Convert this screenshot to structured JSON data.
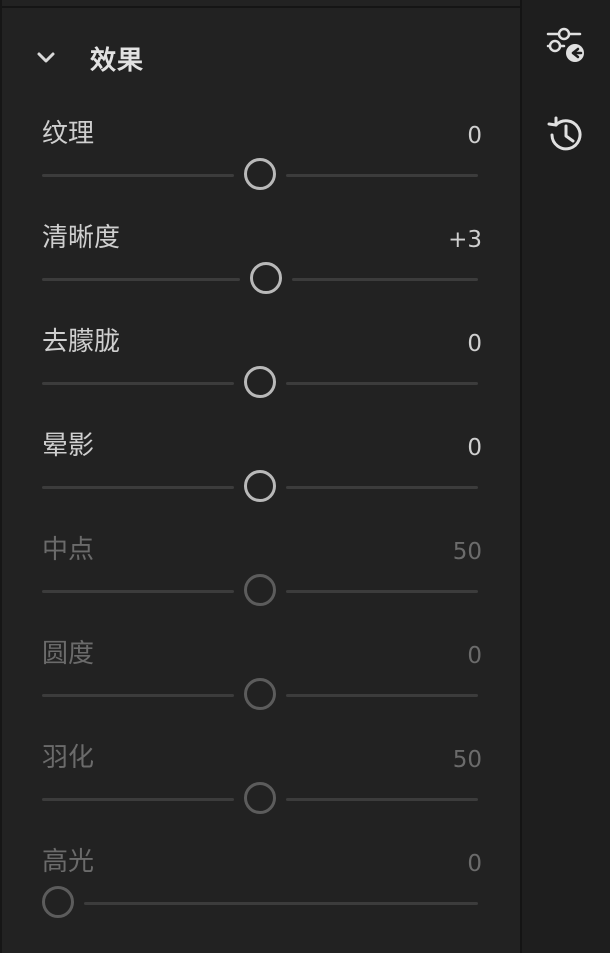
{
  "section": {
    "title": "效果",
    "expanded": true
  },
  "sliders": [
    {
      "label": "纹理",
      "value": "0",
      "numeric": 0,
      "min": -100,
      "max": 100,
      "enabled": true
    },
    {
      "label": "清晰度",
      "value": "+3",
      "numeric": 3,
      "min": -100,
      "max": 100,
      "enabled": true
    },
    {
      "label": "去朦胧",
      "value": "0",
      "numeric": 0,
      "min": -100,
      "max": 100,
      "enabled": true
    },
    {
      "label": "晕影",
      "value": "0",
      "numeric": 0,
      "min": -100,
      "max": 100,
      "enabled": true
    },
    {
      "label": "中点",
      "value": "50",
      "numeric": 50,
      "min": 0,
      "max": 100,
      "enabled": false
    },
    {
      "label": "圆度",
      "value": "0",
      "numeric": 0,
      "min": -100,
      "max": 100,
      "enabled": false
    },
    {
      "label": "羽化",
      "value": "50",
      "numeric": 50,
      "min": 0,
      "max": 100,
      "enabled": false
    },
    {
      "label": "高光",
      "value": "0",
      "numeric": 0,
      "min": 0,
      "max": 100,
      "enabled": false
    }
  ],
  "rail": {
    "icons": [
      "edit-sliders-icon",
      "history-icon"
    ]
  },
  "colors": {
    "panel": "#222222",
    "text": "#cfcfcf",
    "disabled_text": "#6b6b6b",
    "thumb": "#b9b9b9",
    "track": "#3c3c3c"
  }
}
